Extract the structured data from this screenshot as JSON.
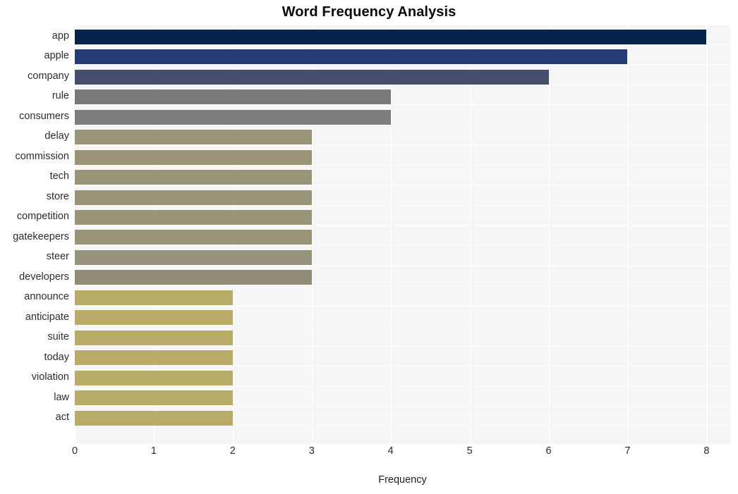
{
  "chart_data": {
    "type": "bar",
    "orientation": "horizontal",
    "title": "Word Frequency Analysis",
    "xlabel": "Frequency",
    "ylabel": "",
    "xlim": [
      0,
      8.3
    ],
    "xticks": [
      0,
      1,
      2,
      3,
      4,
      5,
      6,
      7,
      8
    ],
    "xtick_labels": [
      "0",
      "1",
      "2",
      "3",
      "4",
      "5",
      "6",
      "7",
      "8"
    ],
    "grid": true,
    "legend": null,
    "plot_background": "#f6f6f7",
    "figure_background": "#ffffff",
    "gridline_color": "#ffffff",
    "categories": [
      "app",
      "apple",
      "company",
      "rule",
      "consumers",
      "delay",
      "commission",
      "tech",
      "store",
      "competition",
      "gatekeepers",
      "steer",
      "developers",
      "announce",
      "anticipate",
      "suite",
      "today",
      "violation",
      "law",
      "act"
    ],
    "values": [
      8,
      7,
      6,
      4,
      4,
      3,
      3,
      3,
      3,
      3,
      3,
      3,
      3,
      2,
      2,
      2,
      2,
      2,
      2,
      2
    ],
    "bar_colors": [
      "#062449",
      "#243c73",
      "#454f6d",
      "#79797a",
      "#7d7d7c",
      "#9a9478",
      "#9a9478",
      "#9a9478",
      "#9a9478",
      "#9a9478",
      "#9a9478",
      "#97927b",
      "#918c77",
      "#b8ac68",
      "#b8ac68",
      "#b8ac68",
      "#b8ac68",
      "#b8ac68",
      "#b8ac68",
      "#b8ac68"
    ]
  }
}
